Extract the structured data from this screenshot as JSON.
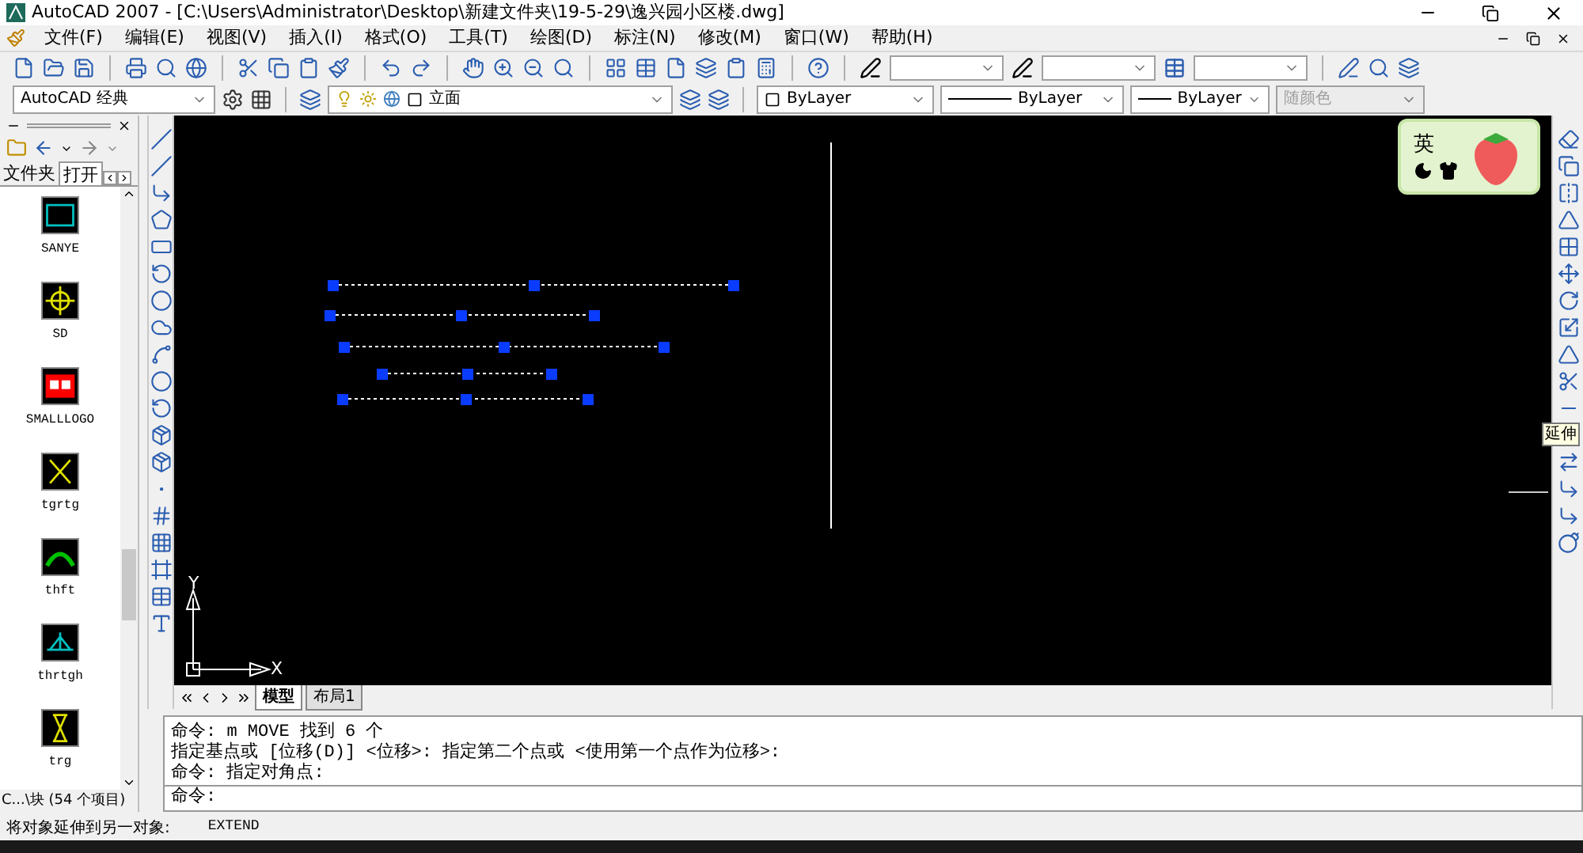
{
  "window": {
    "title": "AutoCAD 2007 - [C:\\Users\\Administrator\\Desktop\\新建文件夹\\19-5-29\\逸兴园小区楼.dwg]"
  },
  "menu": [
    "文件(F)",
    "编辑(E)",
    "视图(V)",
    "插入(I)",
    "格式(O)",
    "工具(T)",
    "绘图(D)",
    "标注(N)",
    "修改(M)",
    "窗口(W)",
    "帮助(H)"
  ],
  "properties": {
    "workspace": "AutoCAD 经典",
    "layer": "立面",
    "color_setting": "ByLayer",
    "linetype": "ByLayer",
    "lineweight": "ByLayer",
    "plot_style": {
      "value": "随颜色",
      "disabled": true
    }
  },
  "palette": {
    "tabs": [
      {
        "label": "文件夹",
        "selected": false
      },
      {
        "label": "打开",
        "selected": true
      }
    ],
    "blocks": [
      {
        "name": "SANYE",
        "color": "#00c0c0"
      },
      {
        "name": "SD",
        "color": "#e0e000"
      },
      {
        "name": "SMALLLOGO",
        "color": "#ff0000"
      },
      {
        "name": "tgrtg",
        "color": "#e0e000"
      },
      {
        "name": "thft",
        "color": "#00c000"
      },
      {
        "name": "thrtgh",
        "color": "#00c0c0"
      },
      {
        "name": "trg",
        "color": "#e0e000"
      }
    ],
    "status": "C...\\块 (54 个项目)"
  },
  "layout_tabs": [
    {
      "label": "模型",
      "selected": true
    },
    {
      "label": "布局1",
      "selected": false
    }
  ],
  "ucs": {
    "x": "X",
    "y": "Y"
  },
  "ime": {
    "mode": "英"
  },
  "tooltip": "延伸",
  "command": {
    "history": [
      "命令: m MOVE 找到 6 个",
      "指定基点或 [位移(D)] <位移>:  指定第二个点或 <使用第一个点作为位移>:",
      "命令: 指定对角点:"
    ],
    "prompt": "命令:"
  },
  "status_bar": {
    "prompt": "将对象延伸到另一对象:",
    "command": "EXTEND"
  }
}
